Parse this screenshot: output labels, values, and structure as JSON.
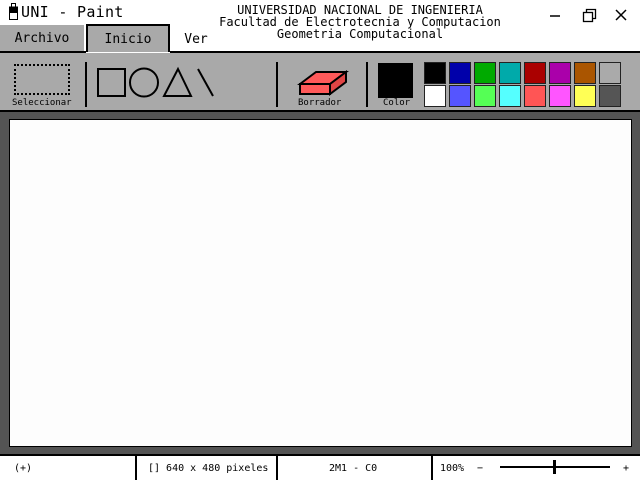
{
  "window": {
    "app_title": "UNI - Paint",
    "header_lines": [
      "UNIVERSIDAD NACIONAL DE INGENIERIA",
      "Facultad de Electrotecnia y Computacion",
      "Geometria Computacional"
    ],
    "controls": [
      "minimize-icon",
      "restore-icon",
      "close-icon"
    ]
  },
  "tabs": [
    {
      "label": "Archivo",
      "active": false
    },
    {
      "label": "Inicio",
      "active": true
    },
    {
      "label": "Ver",
      "active": false
    }
  ],
  "toolbar": {
    "select_label": "Seleccionar",
    "shapes": [
      "rectangle-icon",
      "circle-icon",
      "triangle-icon",
      "line-icon"
    ],
    "eraser_label": "Borrador",
    "color_label": "Color",
    "current_color": "#000000",
    "palette_top": [
      "#000000",
      "#0000aa",
      "#00aa00",
      "#00aaaa",
      "#aa0000",
      "#aa00aa",
      "#aa5500",
      "#aaaaaa"
    ],
    "palette_bottom": [
      "#ffffff",
      "#5555ff",
      "#55ff55",
      "#55ffff",
      "#ff5555",
      "#ff55ff",
      "#ffff55",
      "#555555"
    ]
  },
  "status": {
    "cursor_pos": "(+)",
    "canvas_size": "[] 640 x 480 pixeles",
    "mode": "2M1 - C0",
    "zoom": "100%",
    "zoom_minus": "−",
    "zoom_plus": "+"
  },
  "colors": {
    "toolbar_bg": "#a9a9a9",
    "workspace_bg": "#545454",
    "canvas_bg": "#fdfdfd",
    "eraser_fill": "#ff5a5a"
  }
}
